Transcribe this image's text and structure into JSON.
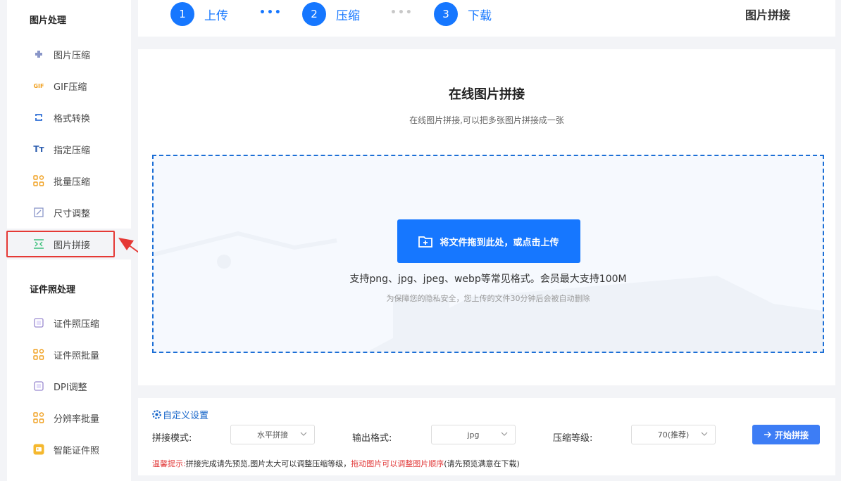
{
  "sidebar": {
    "section1": "图片处理",
    "section2": "证件照处理",
    "items": [
      {
        "label": "图片压缩",
        "icon": "puzzle-icon"
      },
      {
        "label": "GIF压缩",
        "icon": "gif-icon",
        "icon_text": "GIF"
      },
      {
        "label": "格式转换",
        "icon": "convert-icon"
      },
      {
        "label": "指定压缩",
        "icon": "text-icon",
        "icon_text": "Tт"
      },
      {
        "label": "批量压缩",
        "icon": "grid-icon"
      },
      {
        "label": "尺寸调整",
        "icon": "resize-icon"
      },
      {
        "label": "图片拼接",
        "icon": "stitch-icon",
        "active": true
      },
      {
        "label": "证件照压缩",
        "icon": "idphoto-icon"
      },
      {
        "label": "证件照批量",
        "icon": "grid-icon"
      },
      {
        "label": "DPI调整",
        "icon": "dpi-icon"
      },
      {
        "label": "分辨率批量",
        "icon": "grid-icon"
      },
      {
        "label": "智能证件照",
        "icon": "id-card-icon"
      }
    ]
  },
  "header": {
    "steps": [
      {
        "num": "1",
        "label": "上传"
      },
      {
        "num": "2",
        "label": "压缩"
      },
      {
        "num": "3",
        "label": "下载"
      }
    ],
    "dots": "•••",
    "title": "图片拼接"
  },
  "main": {
    "title": "在线图片拼接",
    "subtitle": "在线图片拼接,可以把多张图片拼接成一张",
    "upload_label": "将文件拖到此处，或点击上传",
    "formats": "支持png、jpg、jpeg、webp等常见格式。会员最大支持100M",
    "privacy": "为保障您的隐私安全，您上传的文件30分钟后会被自动删除"
  },
  "settings": {
    "title": "自定义设置",
    "mode_label": "拼接模式:",
    "mode_value": "水平拼接",
    "format_label": "输出格式:",
    "format_value": "jpg",
    "level_label": "压缩等级:",
    "level_value": "70(推荐)",
    "start_label": "开始拼接",
    "tip_prefix": "温馨提示:",
    "tip_part1": "拼接完成请先预览,图片太大可以调整压缩等级，",
    "tip_red": "拖动图片可以调整图片顺序",
    "tip_part2": "(请先预览满意在下载)"
  },
  "colors": {
    "accent": "#1677ff",
    "highlight": "#e53935",
    "dropzone_border": "#1c6fd6"
  }
}
